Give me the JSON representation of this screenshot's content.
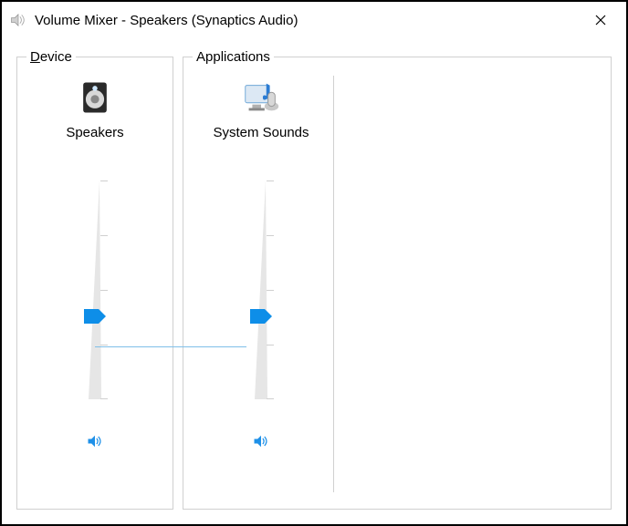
{
  "window": {
    "title": "Volume Mixer - Speakers (Synaptics Audio)"
  },
  "device": {
    "legend": "Device",
    "label": "Speakers",
    "volume": 38,
    "muted": false
  },
  "applications": {
    "legend": "Applications",
    "columns": [
      {
        "label": "System Sounds",
        "volume": 38,
        "muted": false
      }
    ]
  },
  "colors": {
    "accent": "#0078d7"
  }
}
